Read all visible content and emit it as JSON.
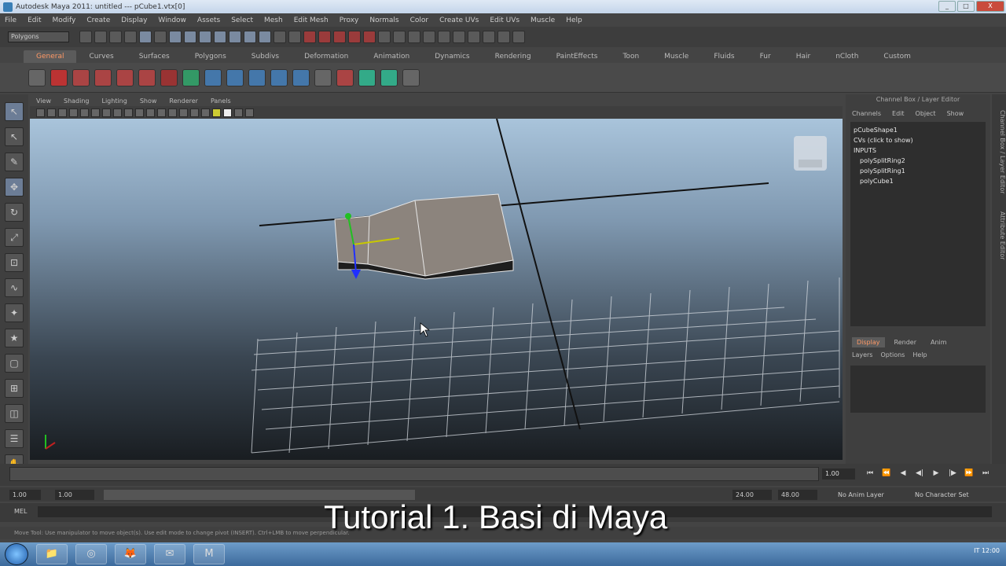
{
  "window": {
    "title": "Autodesk Maya 2011: untitled   ---   pCube1.vtx[0]",
    "buttons": [
      "_",
      "□",
      "X"
    ]
  },
  "menubar": [
    "File",
    "Edit",
    "Modify",
    "Create",
    "Display",
    "Window",
    "Assets",
    "Select",
    "Mesh",
    "Edit Mesh",
    "Proxy",
    "Normals",
    "Color",
    "Create UVs",
    "Edit UVs",
    "Muscle",
    "Help"
  ],
  "status": {
    "mode": "Polygons"
  },
  "shelf_tabs": [
    "General",
    "Curves",
    "Surfaces",
    "Polygons",
    "Subdivs",
    "Deformation",
    "Animation",
    "Dynamics",
    "Rendering",
    "PaintEffects",
    "Toon",
    "Muscle",
    "Fluids",
    "Fur",
    "Hair",
    "nCloth",
    "Custom"
  ],
  "active_shelf_tab": "General",
  "viewport_menu": [
    "View",
    "Shading",
    "Lighting",
    "Show",
    "Renderer",
    "Panels"
  ],
  "right_panel": {
    "header": "Channel Box / Layer Editor",
    "menu": [
      "Channels",
      "Edit",
      "Object",
      "Show"
    ],
    "items": [
      "pCubeShape1",
      "CVs (click to show)",
      "INPUTS",
      "polySplitRing2",
      "polySplitRing1",
      "polyCube1"
    ],
    "layer_tabs": [
      "Display",
      "Render",
      "Anim"
    ],
    "layer_menu": [
      "Layers",
      "Options",
      "Help"
    ],
    "side_labels": [
      "Channel Box / Layer Editor",
      "Attribute Editor"
    ]
  },
  "timeline": {
    "current": "1.00",
    "start": "1.00",
    "range_start": "1.00",
    "range_end": "24.00",
    "end": "48.00",
    "anim_layer": "No Anim Layer",
    "char_set": "No Character Set",
    "playback": [
      "⏮",
      "⏪",
      "◀",
      "◀|",
      "▶",
      "|▶",
      "⏩",
      "⏭"
    ]
  },
  "cmdline": {
    "label": "MEL"
  },
  "helpline": "Move Tool: Use manipulator to move object(s). Use edit mode to change pivot (INSERT). Ctrl+LMB to move perpendicular.",
  "caption": "Tutorial 1. Basi di Maya",
  "taskbar": {
    "apps": [
      "📁",
      "◎",
      "🦊",
      "✉",
      "M"
    ],
    "tray": "IT  12:00"
  }
}
